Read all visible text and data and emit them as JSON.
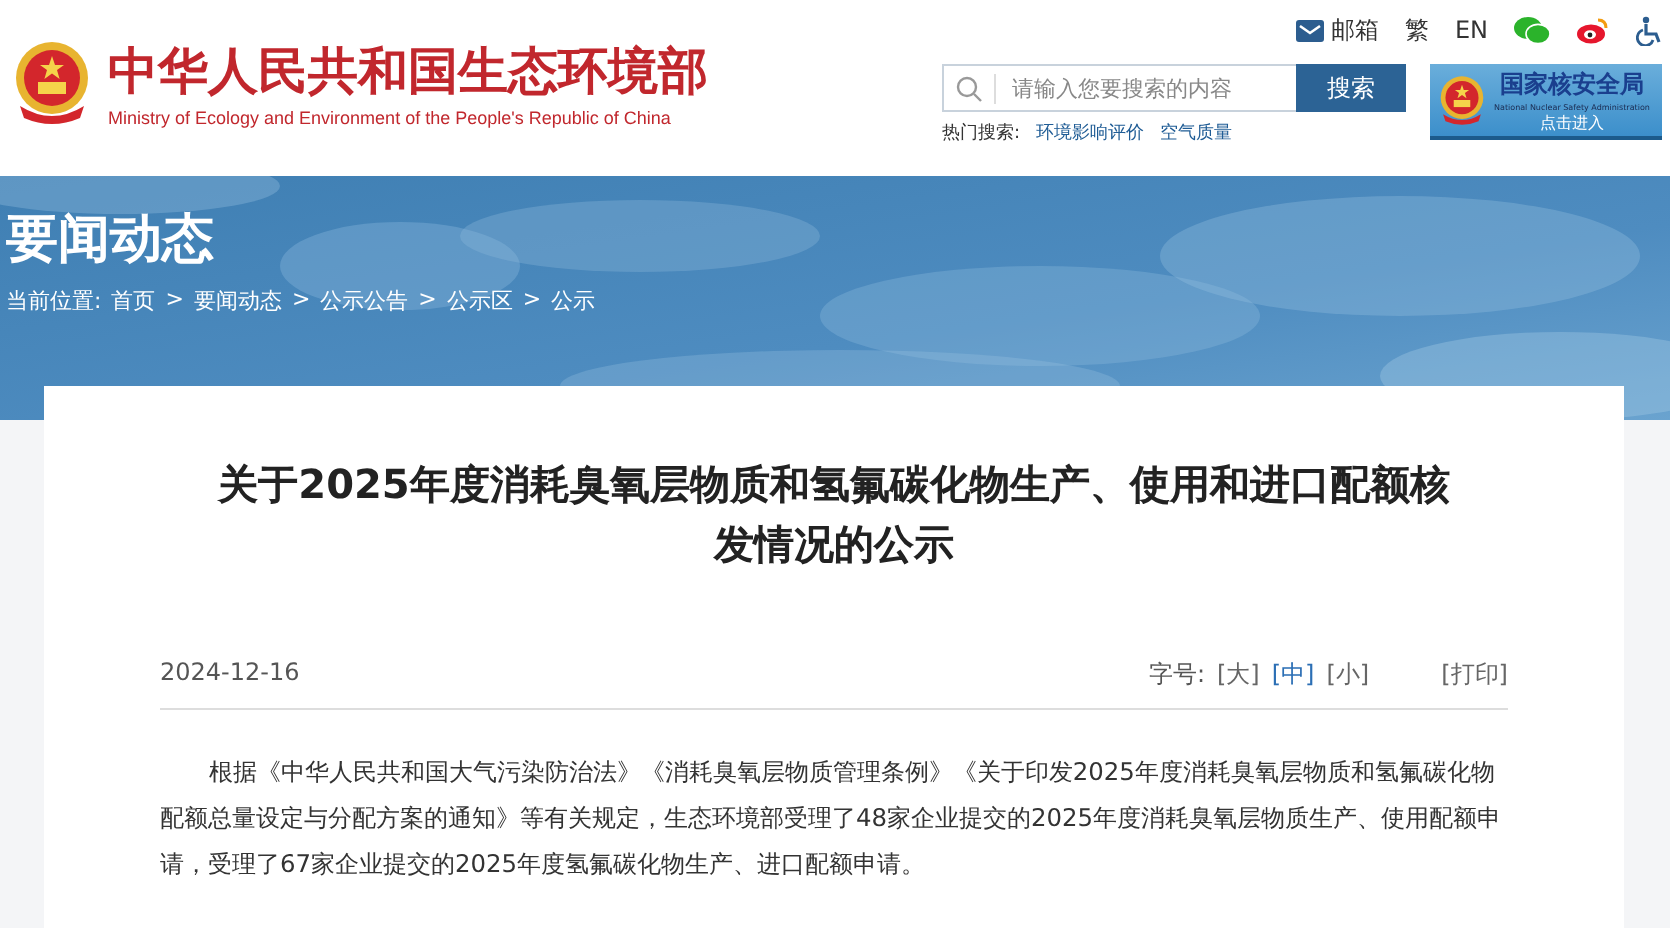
{
  "header": {
    "site_name": "中华人民共和国生态环境部",
    "site_name_en": "Ministry of Ecology and Environment of the People's Republic of China",
    "top_links": [
      {
        "kind": "mail",
        "label": "邮箱"
      },
      {
        "kind": "text",
        "label": "繁"
      },
      {
        "kind": "text",
        "label": "EN"
      },
      {
        "kind": "wechat"
      },
      {
        "kind": "weibo"
      },
      {
        "kind": "accessibility"
      }
    ],
    "search": {
      "placeholder": "请输入您要搜索的内容",
      "button": "搜索",
      "hot_label": "热门搜索:",
      "hot_terms": [
        "环境影响评价",
        "空气质量"
      ]
    },
    "partner": {
      "name": "国家核安全局",
      "name_en": "National Nuclear Safety Administration",
      "action": "点击进入"
    }
  },
  "banner": {
    "kind": "picture",
    "title": "要闻动态",
    "breadcrumb_label": "当前位置:",
    "breadcrumb": [
      "首页",
      "要闻动态",
      "公示公告",
      "公示区",
      "公示"
    ],
    "separator": ">"
  },
  "article": {
    "title": "关于2025年度消耗臭氧层物质和氢氟碳化物生产、使用和进口配额核发情况的公示",
    "date": "2024-12-16",
    "font_size_label": "字号:",
    "font_sizes": [
      {
        "label": "[大]",
        "selected": false
      },
      {
        "label": "[中]",
        "selected": true
      },
      {
        "label": "[小]",
        "selected": false
      }
    ],
    "print": "[打印]",
    "paragraphs": [
      "根据《中华人民共和国大气污染防治法》《消耗臭氧层物质管理条例》《关于印发2025年度消耗臭氧层物质和氢氟碳化物配额总量设定与分配方案的通知》等有关规定，生态环境部受理了48家企业提交的2025年度消耗臭氧层物质生产、使用配额申请，受理了67家企业提交的2025年度氢氟碳化物生产、进口配额申请。"
    ]
  }
}
